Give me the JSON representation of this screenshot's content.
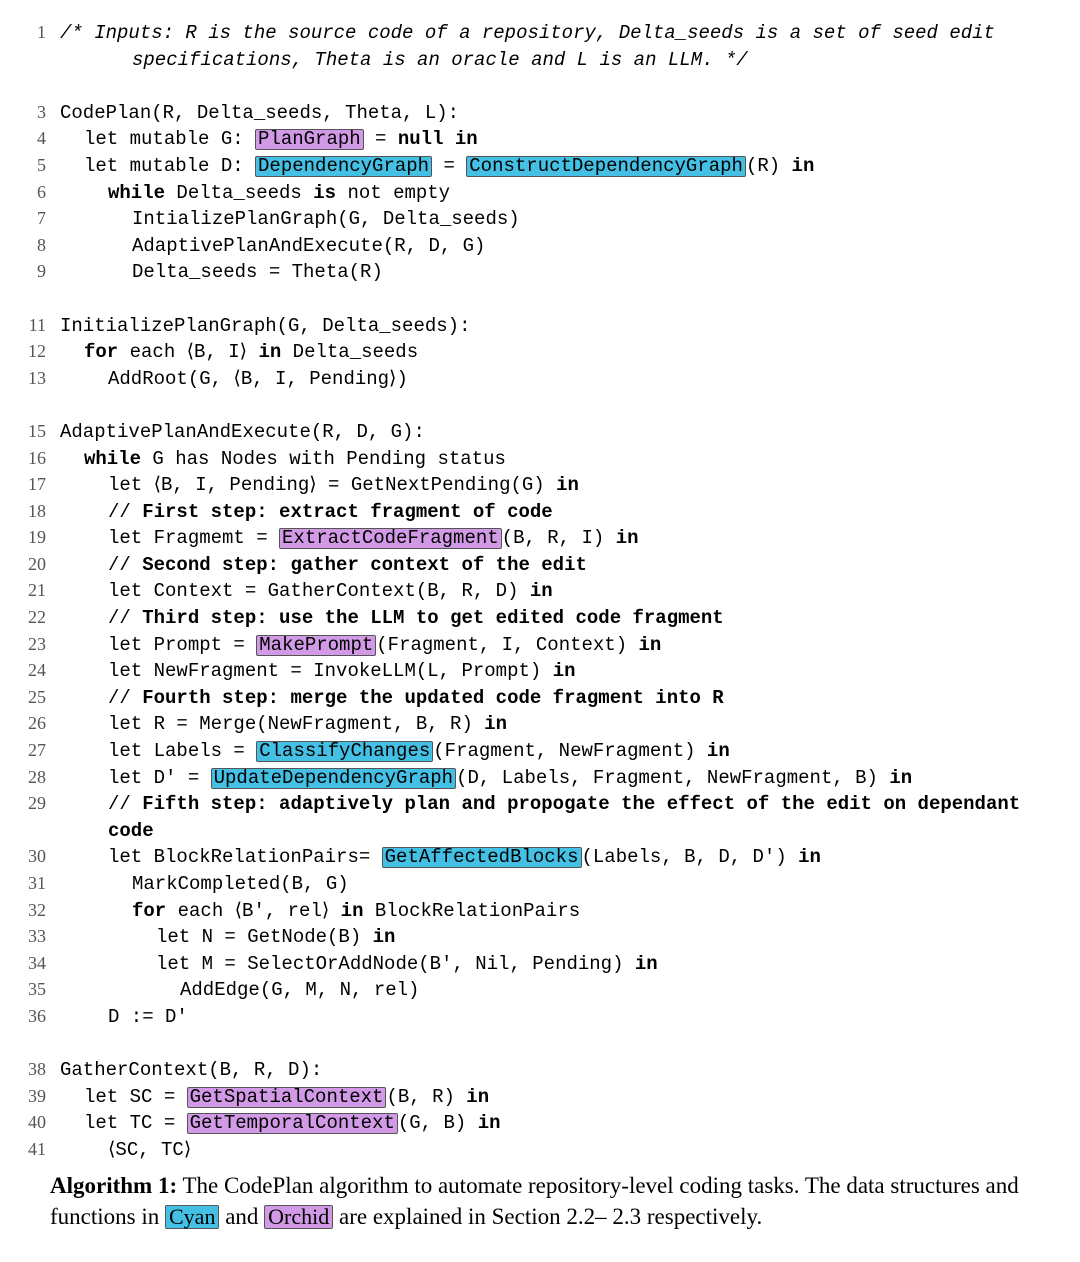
{
  "lines": [
    {
      "n": "1",
      "indent": 0,
      "segs": [
        {
          "t": "/* Inputs: R is the source code of a repository, Delta_seeds is a set of seed edit",
          "cls": "it"
        }
      ]
    },
    {
      "n": "",
      "indent": 3,
      "segs": [
        {
          "t": "specifications, Theta is an oracle and L is an LLM. */",
          "cls": "it"
        }
      ]
    },
    {
      "blank": true
    },
    {
      "n": "3",
      "indent": 0,
      "segs": [
        {
          "t": "CodePlan(R, Delta_seeds, Theta, L):"
        }
      ]
    },
    {
      "n": "4",
      "indent": 1,
      "segs": [
        {
          "t": "let mutable G: "
        },
        {
          "t": "PlanGraph",
          "cls": "orchid"
        },
        {
          "t": " = "
        },
        {
          "t": "null in",
          "cls": "kw"
        }
      ]
    },
    {
      "n": "5",
      "indent": 1,
      "segs": [
        {
          "t": "let mutable D: "
        },
        {
          "t": "DependencyGraph",
          "cls": "cyan"
        },
        {
          "t": " = "
        },
        {
          "t": "ConstructDependencyGraph",
          "cls": "cyan"
        },
        {
          "t": "(R) "
        },
        {
          "t": "in",
          "cls": "kw"
        }
      ]
    },
    {
      "n": "6",
      "indent": 2,
      "segs": [
        {
          "t": "while",
          "cls": "kw"
        },
        {
          "t": " Delta_seeds "
        },
        {
          "t": "is",
          "cls": "kw"
        },
        {
          "t": " not empty"
        }
      ]
    },
    {
      "n": "7",
      "indent": 3,
      "segs": [
        {
          "t": "IntializePlanGraph(G, Delta_seeds)"
        }
      ]
    },
    {
      "n": "8",
      "indent": 3,
      "segs": [
        {
          "t": "AdaptivePlanAndExecute(R, D, G)"
        }
      ]
    },
    {
      "n": "9",
      "indent": 3,
      "segs": [
        {
          "t": "Delta_seeds = Theta(R)"
        }
      ]
    },
    {
      "blank": true
    },
    {
      "n": "11",
      "indent": 0,
      "segs": [
        {
          "t": "InitializePlanGraph(G, Delta_seeds):"
        }
      ]
    },
    {
      "n": "12",
      "indent": 1,
      "segs": [
        {
          "t": "for",
          "cls": "kw"
        },
        {
          "t": " each ⟨B, I⟩ "
        },
        {
          "t": "in",
          "cls": "kw"
        },
        {
          "t": " Delta_seeds"
        }
      ]
    },
    {
      "n": "13",
      "indent": 2,
      "segs": [
        {
          "t": "AddRoot(G, ⟨B, I, Pending⟩)"
        }
      ]
    },
    {
      "blank": true
    },
    {
      "n": "15",
      "indent": 0,
      "segs": [
        {
          "t": "AdaptivePlanAndExecute(R, D, G):"
        }
      ]
    },
    {
      "n": "16",
      "indent": 1,
      "segs": [
        {
          "t": "while",
          "cls": "kw"
        },
        {
          "t": " G has Nodes with Pending status"
        }
      ]
    },
    {
      "n": "17",
      "indent": 2,
      "segs": [
        {
          "t": "let ⟨B, I, Pending⟩ = GetNextPending(G) "
        },
        {
          "t": "in",
          "cls": "kw"
        }
      ]
    },
    {
      "n": "18",
      "indent": 2,
      "segs": [
        {
          "t": "// "
        },
        {
          "t": "First step: extract fragment of code",
          "cls": "kw"
        }
      ]
    },
    {
      "n": "19",
      "indent": 2,
      "segs": [
        {
          "t": "let Fragmemt = "
        },
        {
          "t": "ExtractCodeFragment",
          "cls": "orchid"
        },
        {
          "t": "(B, R, I) "
        },
        {
          "t": "in",
          "cls": "kw"
        }
      ]
    },
    {
      "n": "20",
      "indent": 2,
      "segs": [
        {
          "t": "// "
        },
        {
          "t": "Second step: gather context of the edit",
          "cls": "kw"
        }
      ]
    },
    {
      "n": "21",
      "indent": 2,
      "segs": [
        {
          "t": "let Context = GatherContext(B, R, D) "
        },
        {
          "t": "in",
          "cls": "kw"
        }
      ]
    },
    {
      "n": "22",
      "indent": 2,
      "segs": [
        {
          "t": "// "
        },
        {
          "t": "Third step: use the LLM to get edited code fragment",
          "cls": "kw"
        }
      ]
    },
    {
      "n": "23",
      "indent": 2,
      "segs": [
        {
          "t": "let Prompt = "
        },
        {
          "t": "MakePrompt",
          "cls": "orchid"
        },
        {
          "t": "(Fragment, I, Context) "
        },
        {
          "t": "in",
          "cls": "kw"
        }
      ]
    },
    {
      "n": "24",
      "indent": 2,
      "segs": [
        {
          "t": "let NewFragment = InvokeLLM(L, Prompt) "
        },
        {
          "t": "in",
          "cls": "kw"
        }
      ]
    },
    {
      "n": "25",
      "indent": 2,
      "segs": [
        {
          "t": "// "
        },
        {
          "t": "Fourth step: merge the updated code fragment into R",
          "cls": "kw"
        }
      ]
    },
    {
      "n": "26",
      "indent": 2,
      "segs": [
        {
          "t": "let R = Merge(NewFragment, B, R) "
        },
        {
          "t": "in",
          "cls": "kw"
        }
      ]
    },
    {
      "n": "27",
      "indent": 2,
      "segs": [
        {
          "t": "let Labels = "
        },
        {
          "t": "ClassifyChanges",
          "cls": "cyan"
        },
        {
          "t": "(Fragment, NewFragment) "
        },
        {
          "t": "in",
          "cls": "kw"
        }
      ]
    },
    {
      "n": "28",
      "indent": 2,
      "segs": [
        {
          "t": "let D' = "
        },
        {
          "t": "UpdateDependencyGraph",
          "cls": "cyan"
        },
        {
          "t": "(D, Labels, Fragment, NewFragment, B) "
        },
        {
          "t": "in",
          "cls": "kw"
        }
      ]
    },
    {
      "n": "29",
      "indent": 2,
      "segs": [
        {
          "t": "// "
        },
        {
          "t": "Fifth step: adaptively plan and propogate the effect of the edit on dependant code",
          "cls": "kw"
        }
      ]
    },
    {
      "n": "30",
      "indent": 2,
      "segs": [
        {
          "t": "let BlockRelationPairs= "
        },
        {
          "t": "GetAffectedBlocks",
          "cls": "cyan"
        },
        {
          "t": "(Labels, B, D, D') "
        },
        {
          "t": "in",
          "cls": "kw"
        }
      ]
    },
    {
      "n": "31",
      "indent": 3,
      "segs": [
        {
          "t": "MarkCompleted(B, G)"
        }
      ]
    },
    {
      "n": "32",
      "indent": 3,
      "segs": [
        {
          "t": "for",
          "cls": "kw"
        },
        {
          "t": " each ⟨B', rel⟩ "
        },
        {
          "t": "in",
          "cls": "kw"
        },
        {
          "t": " BlockRelationPairs"
        }
      ]
    },
    {
      "n": "33",
      "indent": 4,
      "segs": [
        {
          "t": "let N = GetNode(B) "
        },
        {
          "t": "in",
          "cls": "kw"
        }
      ]
    },
    {
      "n": "34",
      "indent": 4,
      "segs": [
        {
          "t": "let M = SelectOrAddNode(B', Nil, Pending) "
        },
        {
          "t": "in",
          "cls": "kw"
        }
      ]
    },
    {
      "n": "35",
      "indent": 5,
      "segs": [
        {
          "t": "AddEdge(G, M, N, rel)"
        }
      ]
    },
    {
      "n": "36",
      "indent": 2,
      "segs": [
        {
          "t": "D := D'"
        }
      ]
    },
    {
      "blank": true
    },
    {
      "n": "38",
      "indent": 0,
      "segs": [
        {
          "t": "GatherContext(B, R, D):"
        }
      ]
    },
    {
      "n": "39",
      "indent": 1,
      "segs": [
        {
          "t": "let SC = "
        },
        {
          "t": "GetSpatialContext",
          "cls": "orchid"
        },
        {
          "t": "(B, R) "
        },
        {
          "t": "in",
          "cls": "kw"
        }
      ]
    },
    {
      "n": "40",
      "indent": 1,
      "segs": [
        {
          "t": "let TC = "
        },
        {
          "t": "GetTemporalContext",
          "cls": "orchid"
        },
        {
          "t": "(G, B) "
        },
        {
          "t": "in",
          "cls": "kw"
        }
      ]
    },
    {
      "n": "41",
      "indent": 2,
      "segs": [
        {
          "t": "⟨SC, TC⟩"
        }
      ]
    }
  ],
  "caption": {
    "label": "Algorithm 1:",
    "before": " The CodePlan algorithm to automate repository-level coding tasks. The data structures and functions in ",
    "cyan_word": "Cyan",
    "mid": " and ",
    "orchid_word": "Orchid",
    "after": " are explained in Section 2.2– 2.3 respectively."
  }
}
